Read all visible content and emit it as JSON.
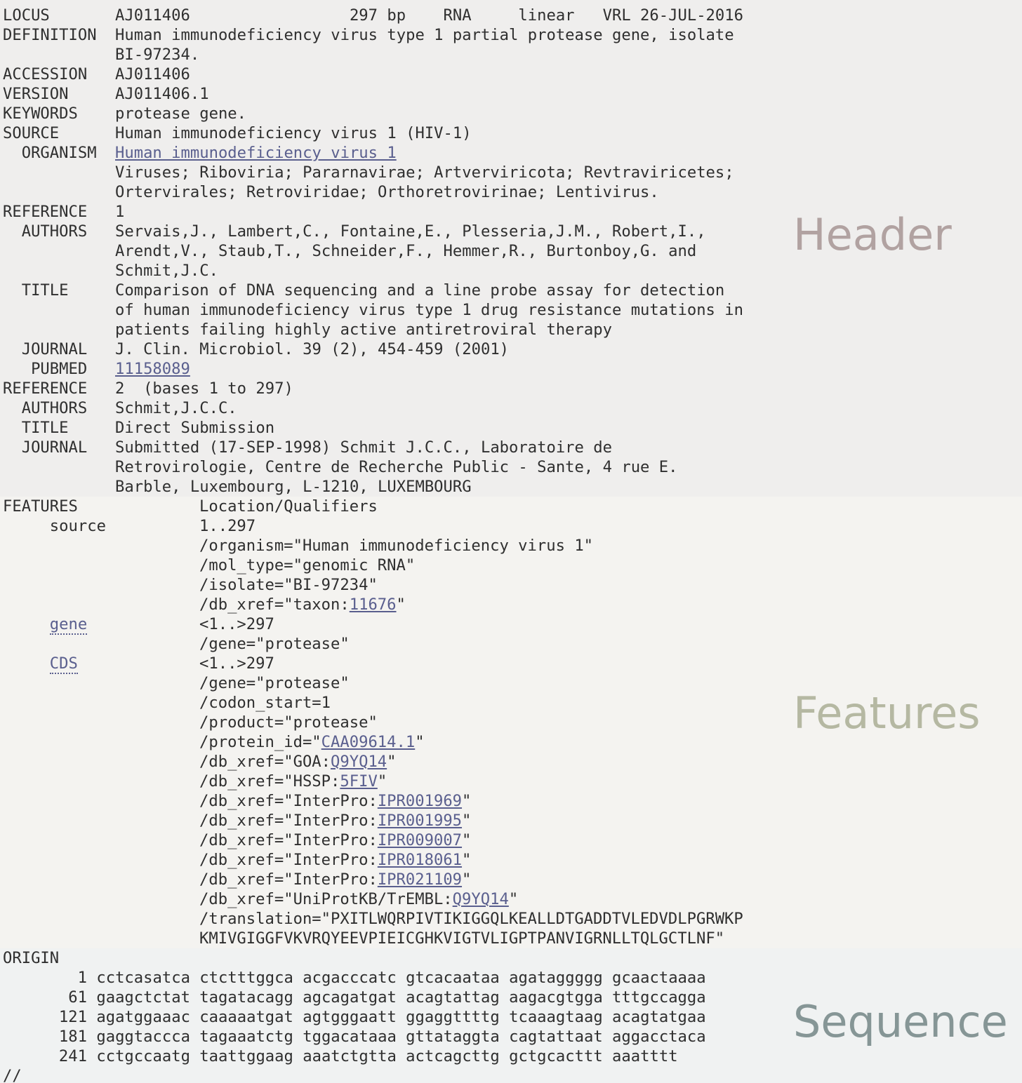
{
  "header": {
    "watermark": "Header",
    "locus": {
      "label": "LOCUS",
      "value": "AJ011406                 297 bp    RNA     linear   VRL 26-JUL-2016"
    },
    "definition": {
      "label": "DEFINITION",
      "line1": "Human immunodeficiency virus type 1 partial protease gene, isolate",
      "line2": "BI-97234."
    },
    "accession": {
      "label": "ACCESSION",
      "value": "AJ011406"
    },
    "version": {
      "label": "VERSION",
      "value": "AJ011406.1"
    },
    "keywords": {
      "label": "KEYWORDS",
      "value": "protease gene."
    },
    "source": {
      "label": "SOURCE",
      "value": "Human immunodeficiency virus 1 (HIV-1)"
    },
    "organism": {
      "label": "  ORGANISM",
      "link": "Human immunodeficiency virus 1",
      "line2": "Viruses; Riboviria; Pararnavirae; Artverviricota; Revtraviricetes;",
      "line3": "Ortervirales; Retroviridae; Orthoretrovirinae; Lentivirus."
    },
    "reference1": {
      "label": "REFERENCE",
      "value": "1",
      "authors_label": "  AUTHORS",
      "authors1": "Servais,J., Lambert,C., Fontaine,E., Plesseria,J.M., Robert,I.,",
      "authors2": "Arendt,V., Staub,T., Schneider,F., Hemmer,R., Burtonboy,G. and",
      "authors3": "Schmit,J.C.",
      "title_label": "  TITLE",
      "title1": "Comparison of DNA sequencing and a line probe assay for detection",
      "title2": "of human immunodeficiency virus type 1 drug resistance mutations in",
      "title3": "patients failing highly active antiretroviral therapy",
      "journal_label": "  JOURNAL",
      "journal": "J. Clin. Microbiol. 39 (2), 454-459 (2001)",
      "pubmed_label": "   PUBMED",
      "pubmed": "11158089"
    },
    "reference2": {
      "label": "REFERENCE",
      "value": "2  (bases 1 to 297)",
      "authors_label": "  AUTHORS",
      "authors": "Schmit,J.C.C.",
      "title_label": "  TITLE",
      "title": "Direct Submission",
      "journal_label": "  JOURNAL",
      "journal1": "Submitted (17-SEP-1998) Schmit J.C.C., Laboratoire de",
      "journal2": "Retrovirologie, Centre de Recherche Public - Sante, 4 rue E.",
      "journal3": "Barble, Luxembourg, L-1210, LUXEMBOURG"
    }
  },
  "features": {
    "watermark": "Features",
    "label": "FEATURES",
    "location_header": "Location/Qualifiers",
    "source": {
      "key": "     source",
      "location": "1..297",
      "organism": "/organism=\"Human immunodeficiency virus 1\"",
      "mol_type": "/mol_type=\"genomic RNA\"",
      "isolate": "/isolate=\"BI-97234\"",
      "db_xref_prefix": "/db_xref=\"taxon:",
      "db_xref_link": "11676",
      "db_xref_suffix": "\""
    },
    "gene": {
      "key": "gene",
      "location": "<1..>297",
      "gene": "/gene=\"protease\""
    },
    "cds": {
      "key": "CDS",
      "location": "<1..>297",
      "gene": "/gene=\"protease\"",
      "codon_start": "/codon_start=1",
      "product": "/product=\"protease\"",
      "protein_id": {
        "prefix": "/protein_id=\"",
        "link": "CAA09614.1",
        "suffix": "\""
      },
      "xrefs": [
        {
          "prefix": "/db_xref=\"GOA:",
          "link": "Q9YQ14",
          "suffix": "\""
        },
        {
          "prefix": "/db_xref=\"HSSP:",
          "link": "5FIV",
          "suffix": "\""
        },
        {
          "prefix": "/db_xref=\"InterPro:",
          "link": "IPR001969",
          "suffix": "\""
        },
        {
          "prefix": "/db_xref=\"InterPro:",
          "link": "IPR001995",
          "suffix": "\""
        },
        {
          "prefix": "/db_xref=\"InterPro:",
          "link": "IPR009007",
          "suffix": "\""
        },
        {
          "prefix": "/db_xref=\"InterPro:",
          "link": "IPR018061",
          "suffix": "\""
        },
        {
          "prefix": "/db_xref=\"InterPro:",
          "link": "IPR021109",
          "suffix": "\""
        },
        {
          "prefix": "/db_xref=\"UniProtKB/TrEMBL:",
          "link": "Q9YQ14",
          "suffix": "\""
        }
      ],
      "translation1": "/translation=\"PXITLWQRPIVTIKIGGQLKEALLDTGADDTVLEDVDLPGRWKP",
      "translation2": "KMIVGIGGFVKVRQYEEVPIEICGHKVIGTVLIGPTPANVIGRNLLTQLGCTLNF\""
    }
  },
  "sequence": {
    "watermark": "Sequence",
    "label": "ORIGIN",
    "rows": [
      {
        "pos": "1",
        "seq": "cctcasatca ctctttggca acgacccatc gtcacaataa agataggggg gcaactaaaa"
      },
      {
        "pos": "61",
        "seq": "gaagctctat tagatacagg agcagatgat acagtattag aagacgtgga tttgccagga"
      },
      {
        "pos": "121",
        "seq": "agatggaaac caaaaatgat agtgggaatt ggaggttttg tcaaagtaag acagtatgaa"
      },
      {
        "pos": "181",
        "seq": "gaggtaccca tagaaatctg tggacataaa gttataggta cagtattaat aggacctaca"
      },
      {
        "pos": "241",
        "seq": "cctgccaatg taattggaag aaatctgtta actcagcttg gctgcacttt aaatttt"
      }
    ],
    "terminator": "//"
  }
}
